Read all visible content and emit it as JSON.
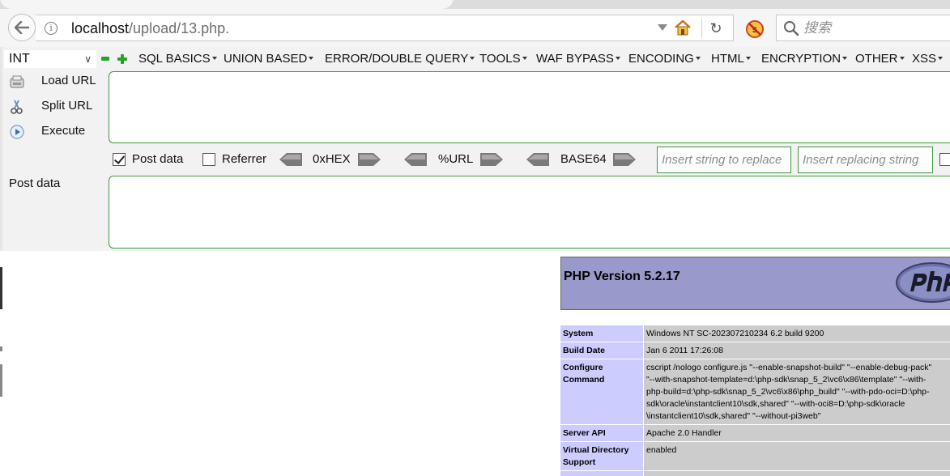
{
  "browser": {
    "url_host": "localhost",
    "url_path": "/upload/13.php.",
    "search_placeholder": "搜索"
  },
  "hackbar": {
    "select_value": "INT",
    "menu": [
      "SQL BASICS",
      "UNION BASED",
      "ERROR/DOUBLE QUERY",
      "TOOLS",
      "WAF BYPASS",
      "ENCODING",
      "HTML",
      "ENCRYPTION",
      "OTHER",
      "XSS"
    ],
    "buttons": {
      "load_url": "Load URL",
      "split_url": "Split URL",
      "execute": "Execute"
    },
    "options": {
      "post_data": "Post data",
      "post_data_checked": true,
      "referrer": "Referrer",
      "referrer_checked": false,
      "hex": "0xHEX",
      "url_enc": "%URL",
      "base64": "BASE64",
      "replace_placeholder": "Insert string to replace",
      "replacing_placeholder": "Insert replacing string"
    },
    "post_label": "Post data",
    "colors": {
      "accent_green": "#3d9a3d"
    }
  },
  "php": {
    "title": "PHP Version 5.2.17",
    "rows": [
      {
        "key": "System",
        "value": "Windows NT SC-202307210234 6.2 build 9200"
      },
      {
        "key": "Build Date",
        "value": "Jan 6 2011 17:26:08"
      },
      {
        "key": "Configure Command",
        "value": "cscript /nologo configure.js \"--enable-snapshot-build\" \"--enable-debug-pack\" \"--with-snapshot-template=d:\\php-sdk\\snap_5_2\\vc6\\x86\\template\" \"--with-php-build=d:\\php-sdk\\snap_5_2\\vc6\\x86\\php_build\" \"--with-pdo-oci=D:\\php-sdk\\oracle\\instantclient10\\sdk,shared\" \"--with-oci8=D:\\php-sdk\\oracle\\instantclient10\\sdk,shared\" \"--without-pi3web\""
      },
      {
        "key": "Server API",
        "value": "Apache 2.0 Handler"
      },
      {
        "key": "Virtual Directory Support",
        "value": "enabled"
      }
    ],
    "configure_lines": [
      "cscript /nologo configure.js \"--enable-snapshot-build\" \"--enable-debug-pack\"",
      "\"--with-snapshot-template=d:\\php-sdk\\snap_5_2\\vc6\\x86\\template\" \"--with-",
      "php-build=d:\\php-sdk\\snap_5_2\\vc6\\x86\\php_build\" \"--with-pdo-oci=D:\\php-",
      "sdk\\oracle\\instantclient10\\sdk,shared\" \"--with-oci8=D:\\php-sdk\\oracle",
      "\\instantclient10\\sdk,shared\" \"--without-pi3web\""
    ],
    "colors": {
      "header": "#9999cc",
      "key_bg": "#ccccff",
      "val_bg": "#cccccc"
    }
  }
}
